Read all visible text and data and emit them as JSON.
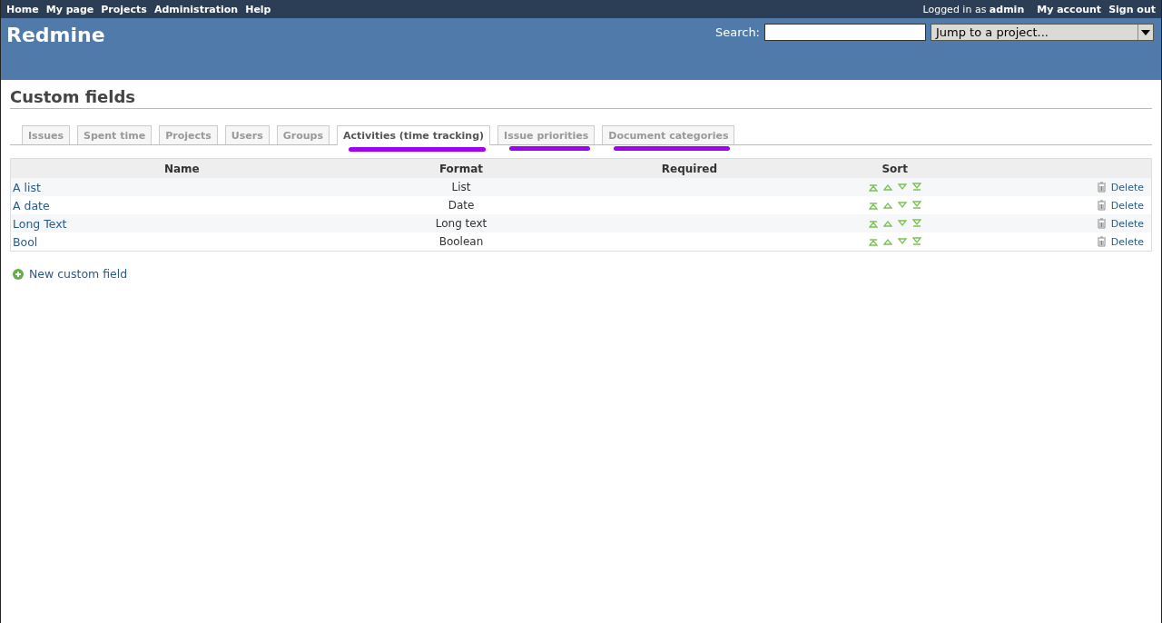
{
  "top_menu": {
    "left": [
      "Home",
      "My page",
      "Projects",
      "Administration",
      "Help"
    ],
    "logged_in_prefix": "Logged in as",
    "logged_in_user": "admin",
    "right": [
      "My account",
      "Sign out"
    ]
  },
  "header": {
    "title": "Redmine",
    "search_label": "Search:",
    "jump_placeholder": "Jump to a project..."
  },
  "page_title": "Custom fields",
  "tabs": [
    {
      "label": "Issues",
      "selected": false,
      "marked": false
    },
    {
      "label": "Spent time",
      "selected": false,
      "marked": false
    },
    {
      "label": "Projects",
      "selected": false,
      "marked": false
    },
    {
      "label": "Users",
      "selected": false,
      "marked": false
    },
    {
      "label": "Groups",
      "selected": false,
      "marked": false
    },
    {
      "label": "Activities (time tracking)",
      "selected": true,
      "marked": true
    },
    {
      "label": "Issue priorities",
      "selected": false,
      "marked": true
    },
    {
      "label": "Document categories",
      "selected": false,
      "marked": true
    }
  ],
  "table": {
    "columns": [
      "Name",
      "Format",
      "Required",
      "Sort"
    ],
    "rows": [
      {
        "name": "A list",
        "format": "List",
        "action": "Delete"
      },
      {
        "name": "A date",
        "format": "Date",
        "action": "Delete"
      },
      {
        "name": "Long Text",
        "format": "Long text",
        "action": "Delete"
      },
      {
        "name": "Bool",
        "format": "Boolean",
        "action": "Delete"
      }
    ]
  },
  "new_link": "New custom field"
}
